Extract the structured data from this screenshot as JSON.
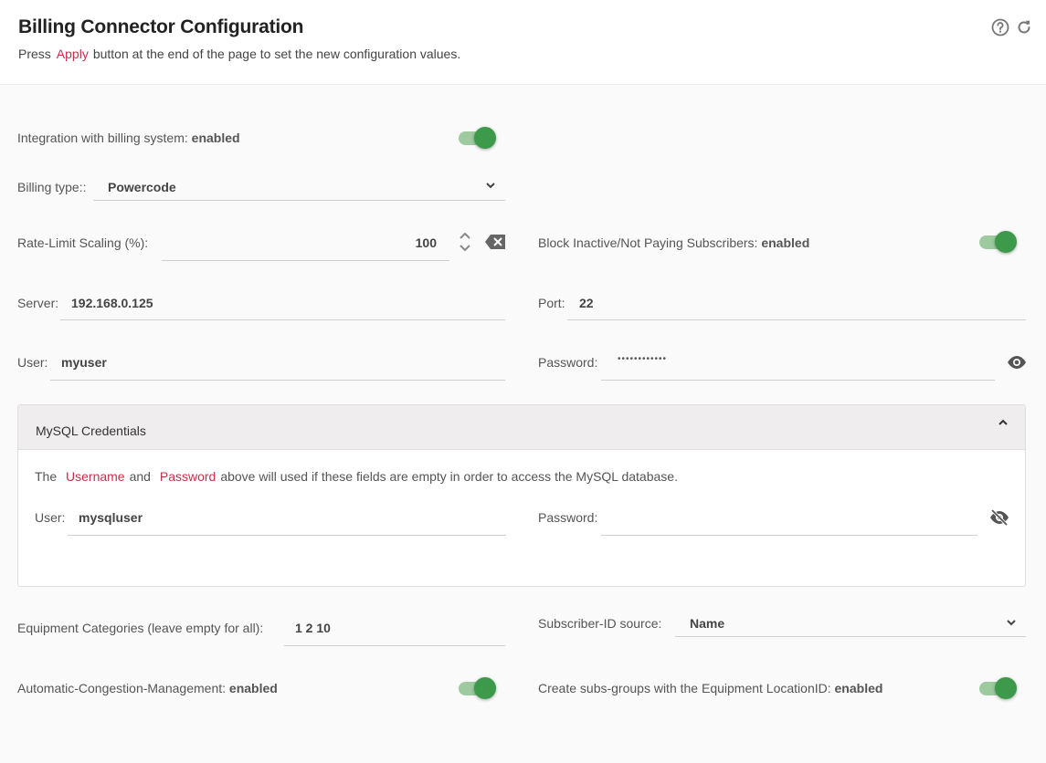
{
  "header": {
    "title": "Billing Connector Configuration",
    "subtitle_pre": "Press",
    "subtitle_link": "Apply",
    "subtitle_post": "button at the end of the page to set the new configuration values.",
    "help_icon": "help-circle-icon",
    "refresh_icon": "refresh-icon"
  },
  "integration": {
    "label": "Integration with billing system:",
    "state": "enabled",
    "on": true
  },
  "billing_type": {
    "label": "Billing type::",
    "value": "Powercode"
  },
  "rate_limit": {
    "label": "Rate-Limit Scaling (%):",
    "value": "100"
  },
  "block_inactive": {
    "label": "Block Inactive/Not Paying Subscribers:",
    "state": "enabled",
    "on": true
  },
  "server": {
    "label": "Server:",
    "value": "192.168.0.125"
  },
  "port": {
    "label": "Port:",
    "value": "22"
  },
  "user": {
    "label": "User:",
    "value": "myuser"
  },
  "password": {
    "label": "Password:",
    "value": "••••••••••••"
  },
  "mysql": {
    "title": "MySQL Credentials",
    "note_the": "The",
    "note_username": "Username",
    "note_and": "and",
    "note_password": "Password",
    "note_rest": "above will used if these fields are empty in order to access the MySQL database.",
    "user_label": "User:",
    "user_value": "mysqluser",
    "password_label": "Password:",
    "password_value": ""
  },
  "equipment": {
    "label": "Equipment Categories (leave empty for all):",
    "value": "1 2 10"
  },
  "subscriber_id": {
    "label": "Subscriber-ID source:",
    "value": "Name"
  },
  "acm": {
    "label": "Automatic-Congestion-Management:",
    "state": "enabled",
    "on": true
  },
  "subs_groups": {
    "label": "Create subs-groups with the Equipment LocationID:",
    "state": "enabled",
    "on": true
  },
  "colors": {
    "accent_red": "#c4314b",
    "toggle_on": "#3c9a4a",
    "toggle_track": "#9dcb9f"
  }
}
